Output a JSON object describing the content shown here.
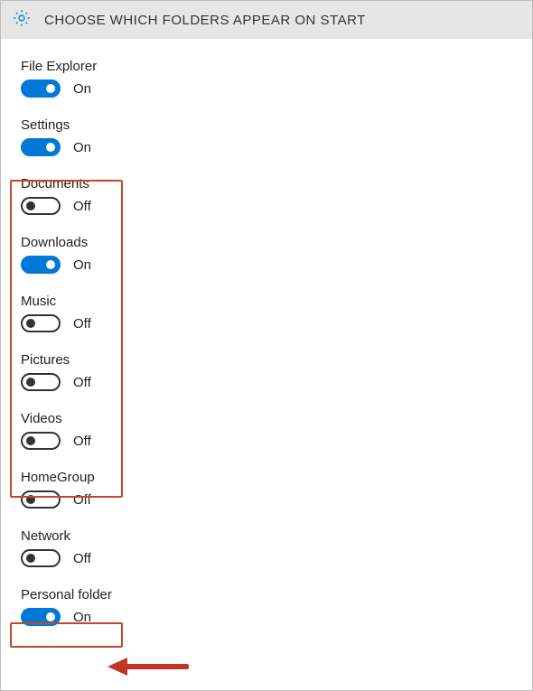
{
  "header": {
    "title": "CHOOSE WHICH FOLDERS APPEAR ON START",
    "icon": "gear-icon"
  },
  "labels": {
    "on_text": "On",
    "off_text": "Off"
  },
  "settings": [
    {
      "key": "file-explorer",
      "label": "File Explorer",
      "on": true
    },
    {
      "key": "settings",
      "label": "Settings",
      "on": true
    },
    {
      "key": "documents",
      "label": "Documents",
      "on": false
    },
    {
      "key": "downloads",
      "label": "Downloads",
      "on": true
    },
    {
      "key": "music",
      "label": "Music",
      "on": false
    },
    {
      "key": "pictures",
      "label": "Pictures",
      "on": false
    },
    {
      "key": "videos",
      "label": "Videos",
      "on": false
    },
    {
      "key": "homegroup",
      "label": "HomeGroup",
      "on": false
    },
    {
      "key": "network",
      "label": "Network",
      "on": false
    },
    {
      "key": "personal-folder",
      "label": "Personal folder",
      "on": true
    }
  ]
}
